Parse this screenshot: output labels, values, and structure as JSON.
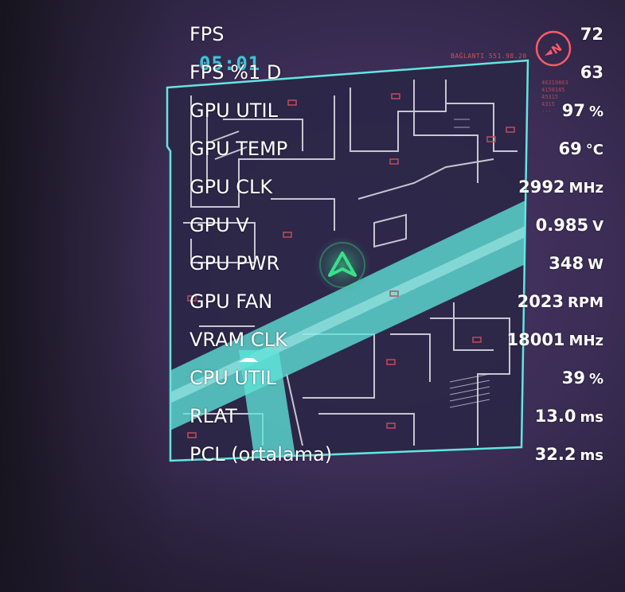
{
  "hud": {
    "clock": "05:01",
    "connection": "BAĞLANTI 551.98.20",
    "numbers": [
      "46319863",
      "4150185",
      "45315",
      "4315",
      "---"
    ],
    "compass_letter": "N",
    "colors": {
      "map_frame": "#62e6df",
      "road": "#5fe3d8",
      "player_marker": "#39e08a",
      "accent_red": "#ff5a6a"
    }
  },
  "overlay": {
    "rows": [
      {
        "label": "FPS",
        "value": "72",
        "unit": ""
      },
      {
        "label": "FPS %1 D",
        "value": "63",
        "unit": ""
      },
      {
        "label": "GPU UTIL",
        "value": "97",
        "unit": "%"
      },
      {
        "label": "GPU TEMP",
        "value": "69",
        "unit": "°C"
      },
      {
        "label": "GPU CLK",
        "value": "2992",
        "unit": "MHz"
      },
      {
        "label": "GPU V",
        "value": "0.985",
        "unit": "V"
      },
      {
        "label": "GPU PWR",
        "value": "348",
        "unit": "W"
      },
      {
        "label": "GPU FAN",
        "value": "2023",
        "unit": "RPM"
      },
      {
        "label": "VRAM CLK",
        "value": "18001",
        "unit": "MHz"
      },
      {
        "label": "CPU UTIL",
        "value": "39",
        "unit": "%"
      },
      {
        "label": "RLAT",
        "value": "13.0",
        "unit": "ms"
      },
      {
        "label": "PCL (ortalama)",
        "value": "32.2",
        "unit": "ms"
      }
    ]
  }
}
